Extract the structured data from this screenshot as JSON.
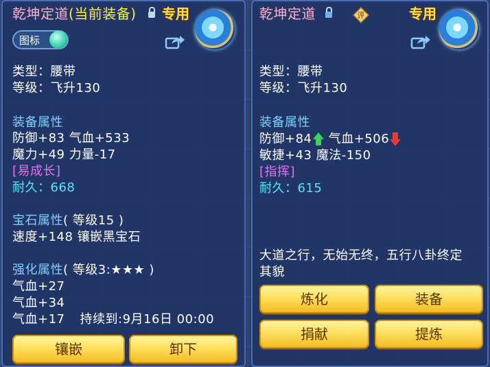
{
  "left": {
    "title": "乾坤定道",
    "equipped_tag": "(当前装备)",
    "exclusive": "专用",
    "icon_toggle_label": "图标",
    "type": "类型：腰带",
    "level": "等级：飞升130",
    "section_attrs": "装备属性",
    "attr_line1": "防御+83 气血+533",
    "attr_line2": "魔力+49 力量-17",
    "special": "[易成长]",
    "durability_label": "耐久：",
    "durability_value": "668",
    "gem_section": "宝石属性",
    "gem_level": "( 等级15 )",
    "gem_line": "速度+148 镶嵌黑宝石",
    "enhance_section": "强化属性",
    "enhance_level": "( 等级3:★★★ )",
    "enhance_line1": "气血+27",
    "enhance_line2": "气血+34",
    "enhance_line3": "气血+17",
    "enhance_duration": "持续到:9月16日 00:00",
    "btn_inlay": "镶嵌",
    "btn_unequip": "卸下"
  },
  "right": {
    "title": "乾坤定道",
    "review_label": "评",
    "exclusive": "专用",
    "type": "类型：腰带",
    "level": "等级：飞升130",
    "section_attrs": "装备属性",
    "attr_defense": "防御+84",
    "attr_hp": "气血+506",
    "attr_line2": "敏捷+43 魔法-150",
    "special": "[指挥]",
    "durability_label": "耐久：",
    "durability_value": "615",
    "desc_line1": "大道之行，无始无终，五行八卦终定",
    "desc_line2": "其貌",
    "btn_refine": "炼化",
    "btn_equip": "装备",
    "btn_donate": "捐献",
    "btn_extract": "提炼"
  },
  "colors": {
    "title": "#ffb0c8",
    "equipped": "#ffee44",
    "section": "#7fd0ff",
    "special": "#f06cf0",
    "durability": "#55e6ff",
    "button": "#ffe060",
    "stat_up": "#3fd05a",
    "stat_down": "#e83a3a"
  },
  "icons": [
    "lock-icon",
    "share-icon",
    "exclusive-emblem-icon",
    "review-badge-icon",
    "arrow-up-icon",
    "arrow-down-icon"
  ]
}
